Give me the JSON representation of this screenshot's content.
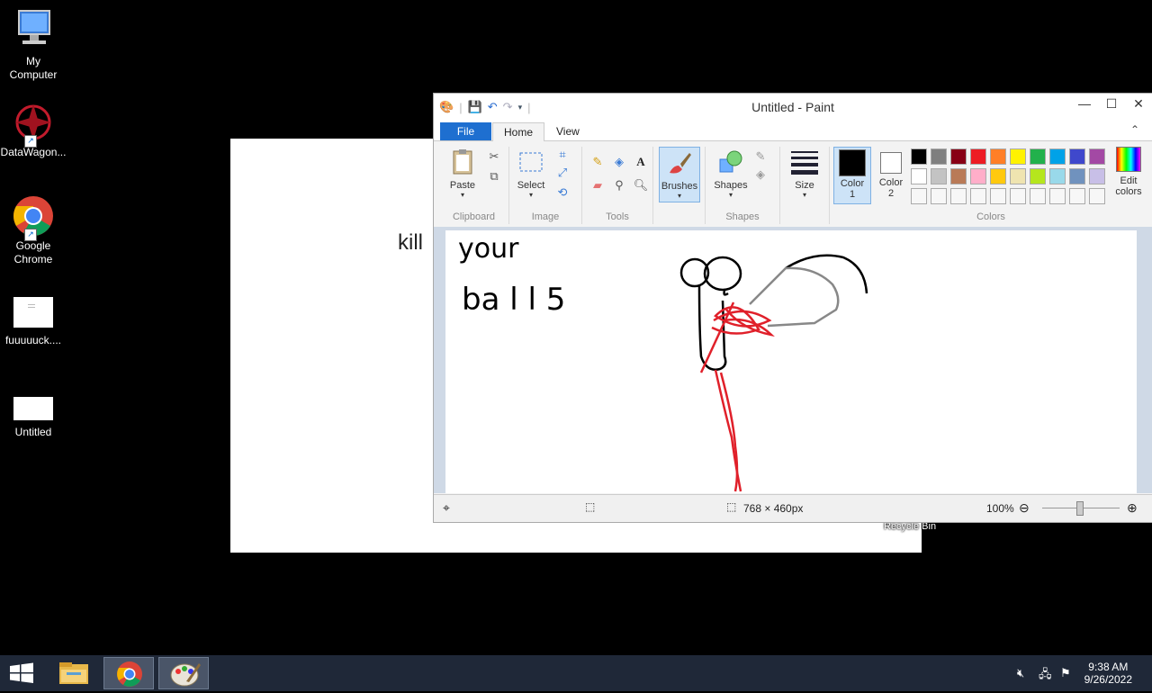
{
  "desktop": {
    "icons": [
      {
        "label": "My\nComputer",
        "icon": "computer-icon"
      },
      {
        "label": "DataWagon...",
        "icon": "datawagon-icon"
      },
      {
        "label": "Google\nChrome",
        "icon": "chrome-icon"
      },
      {
        "label": "fuuuuuck....",
        "icon": "document-icon"
      },
      {
        "label": "Untitled",
        "icon": "image-file-icon"
      }
    ],
    "background_text": "kill",
    "recycle_label": "Recycle Bin"
  },
  "paint": {
    "title": "Untitled - Paint",
    "tabs": {
      "file": "File",
      "home": "Home",
      "view": "View"
    },
    "clipboard": {
      "paste": "Paste",
      "label": "Clipboard"
    },
    "image": {
      "select": "Select",
      "label": "Image"
    },
    "tools": {
      "label": "Tools"
    },
    "brushes": {
      "label": "Brushes"
    },
    "shapes": {
      "button": "Shapes",
      "label": "Shapes"
    },
    "size": {
      "label": "Size"
    },
    "colors": {
      "color1": "Color\n1",
      "color2": "Color\n2",
      "edit": "Edit\ncolors",
      "label": "Colors",
      "color1_value": "#000000",
      "color2_value": "#ffffff",
      "palette_row1": [
        "#000000",
        "#7f7f7f",
        "#880015",
        "#ed1c24",
        "#ff7f27",
        "#fff200",
        "#22b14c",
        "#00a2e8",
        "#3f48cc",
        "#a349a4"
      ],
      "palette_row2": [
        "#ffffff",
        "#c3c3c3",
        "#b97a57",
        "#ffaec9",
        "#ffc90e",
        "#efe4b0",
        "#b5e61d",
        "#99d9ea",
        "#7092be",
        "#c8bfe7"
      ]
    },
    "canvas": {
      "text_line1": "your",
      "text_line2": "ba l l 5"
    },
    "status": {
      "dimensions": "768 × 460px",
      "zoom": "100%"
    }
  },
  "taskbar": {
    "time": "9:38 AM",
    "date": "9/26/2022"
  }
}
